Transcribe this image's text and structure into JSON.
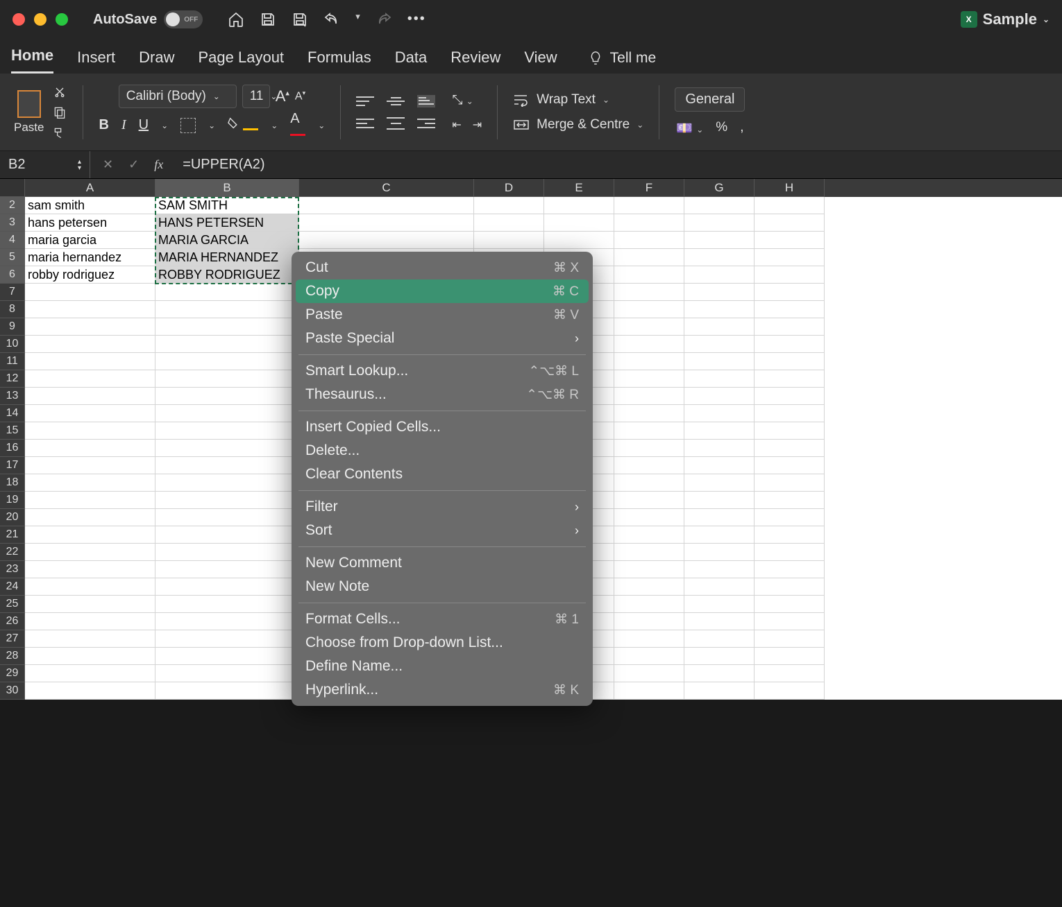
{
  "titlebar": {
    "autosave_label": "AutoSave",
    "autosave_state": "OFF",
    "doc_name": "Sample"
  },
  "tabs": [
    "Home",
    "Insert",
    "Draw",
    "Page Layout",
    "Formulas",
    "Data",
    "Review",
    "View"
  ],
  "tellme": "Tell me",
  "ribbon": {
    "paste": "Paste",
    "font_name": "Calibri (Body)",
    "font_size": "11",
    "wrap_text": "Wrap Text",
    "merge_centre": "Merge & Centre",
    "number_format": "General"
  },
  "formula_bar": {
    "name_box": "B2",
    "formula": "=UPPER(A2)"
  },
  "grid": {
    "columns": [
      "A",
      "B",
      "C",
      "D",
      "E",
      "F",
      "G",
      "H"
    ],
    "row_count": 30,
    "selected_col_index": 1,
    "selected_rows": [
      2,
      3,
      4,
      5,
      6
    ],
    "data_a": {
      "2": "sam smith",
      "3": "hans petersen",
      "4": "maria garcia",
      "5": "maria hernandez",
      "6": "robby rodriguez"
    },
    "data_b": {
      "2": "SAM SMITH",
      "3": "HANS PETERSEN",
      "4": "MARIA GARCIA",
      "5": "MARIA HERNANDEZ",
      "6": "ROBBY RODRIGUEZ"
    }
  },
  "context_menu": {
    "items": [
      {
        "label": "Cut",
        "shortcut": "⌘ X"
      },
      {
        "label": "Copy",
        "shortcut": "⌘ C",
        "highlight": true
      },
      {
        "label": "Paste",
        "shortcut": "⌘ V"
      },
      {
        "label": "Paste Special",
        "submenu": true
      },
      {
        "sep": true
      },
      {
        "label": "Smart Lookup...",
        "shortcut": "⌃⌥⌘ L"
      },
      {
        "label": "Thesaurus...",
        "shortcut": "⌃⌥⌘ R"
      },
      {
        "sep": true
      },
      {
        "label": "Insert Copied Cells..."
      },
      {
        "label": "Delete..."
      },
      {
        "label": "Clear Contents"
      },
      {
        "sep": true
      },
      {
        "label": "Filter",
        "submenu": true
      },
      {
        "label": "Sort",
        "submenu": true
      },
      {
        "sep": true
      },
      {
        "label": "New Comment"
      },
      {
        "label": "New Note"
      },
      {
        "sep": true
      },
      {
        "label": "Format Cells...",
        "shortcut": "⌘ 1"
      },
      {
        "label": "Choose from Drop-down List..."
      },
      {
        "label": "Define Name..."
      },
      {
        "label": "Hyperlink...",
        "shortcut": "⌘ K"
      }
    ]
  }
}
